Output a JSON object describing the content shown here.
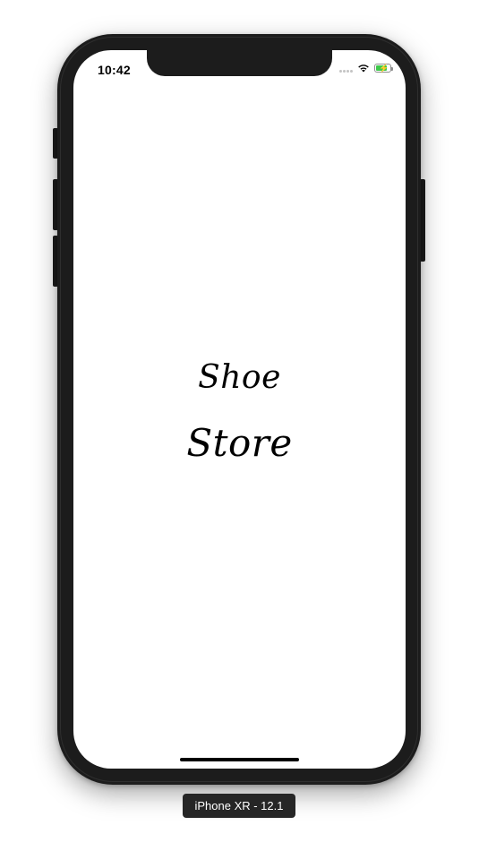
{
  "status_bar": {
    "time": "10:42",
    "icons": [
      "signal-dots-icon",
      "wifi-icon",
      "battery-charging-icon"
    ],
    "battery_color": "#3ec94a"
  },
  "app": {
    "logo_line1": "Shoe",
    "logo_line2": "Store"
  },
  "simulator": {
    "device_label": "iPhone XR - 12.1"
  },
  "colors": {
    "device_body": "#1c1c1c",
    "screen_background": "#ffffff",
    "logo_text": "#000000"
  }
}
